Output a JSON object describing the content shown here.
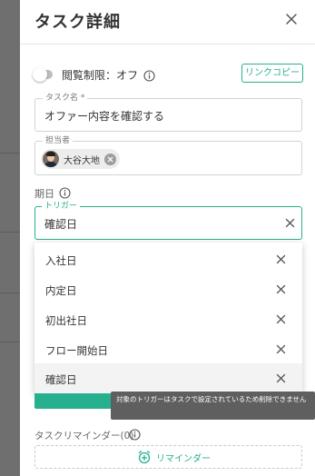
{
  "header": {
    "title": "タスク詳細"
  },
  "access": {
    "label": "閲覧制限：オフ",
    "link_copy": "リンクコピー"
  },
  "task_name": {
    "label": "タスク名 *",
    "value": "オファー内容を確認する"
  },
  "assignee": {
    "label": "担当者",
    "name": "大谷大地"
  },
  "due": {
    "label": "期日"
  },
  "trigger": {
    "label": "トリガー",
    "value": "確認日",
    "options": [
      {
        "label": "入社日"
      },
      {
        "label": "内定日"
      },
      {
        "label": "初出社日"
      },
      {
        "label": "フロー開始日"
      },
      {
        "label": "確認日"
      }
    ]
  },
  "tooltip": {
    "text": "対象のトリガーはタスクで設定されているため削除できません"
  },
  "reminder": {
    "label": "タスクリマインダー(0)",
    "button": "リマインダー"
  },
  "colors": {
    "accent": "#27b08f",
    "backdrop": "#6f6f6f",
    "tooltip": "#5f5f5f"
  }
}
